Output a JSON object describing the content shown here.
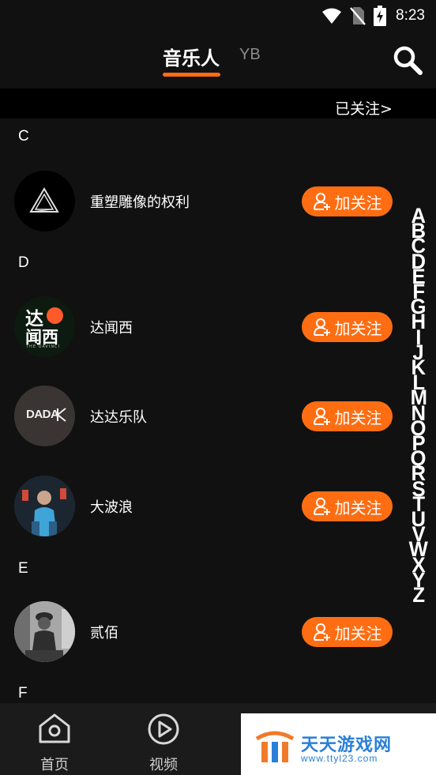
{
  "status_bar": {
    "time": "8:23",
    "icons": [
      "wifi-icon",
      "no-sim-icon",
      "battery-charging-icon"
    ]
  },
  "header": {
    "tab_active": "音乐人",
    "tab_other": "YB",
    "search_icon": "search-icon",
    "accent_color": "#ff6d13"
  },
  "followed_link": "已关注>",
  "sections": [
    {
      "letter": "C",
      "artists": [
        {
          "name": "重塑雕像的权利"
        }
      ]
    },
    {
      "letter": "D",
      "artists": [
        {
          "name": "达闻西"
        },
        {
          "name": "达达乐队"
        },
        {
          "name": "大波浪"
        }
      ]
    },
    {
      "letter": "E",
      "artists": [
        {
          "name": "贰佰"
        }
      ]
    },
    {
      "letter": "F",
      "artists": []
    }
  ],
  "follow_button_label": "加关注",
  "avatar_texts": {
    "dawenxi_top": "达",
    "dawenxi_bottom": "闻西",
    "dawenxi_sub": "THE DAVINCI",
    "dada": "DADA"
  },
  "alpha_index": [
    "A",
    "B",
    "C",
    "D",
    "E",
    "F",
    "G",
    "H",
    "I",
    "J",
    "K",
    "L",
    "M",
    "N",
    "O",
    "P",
    "Q",
    "R",
    "S",
    "T",
    "U",
    "V",
    "W",
    "X",
    "Y",
    "Z"
  ],
  "bottom_nav": [
    {
      "label": "首页",
      "icon": "home-icon"
    },
    {
      "label": "视频",
      "icon": "video-play-icon"
    }
  ],
  "watermark": {
    "title": "天天游戏网",
    "url": "www.ttyl23.com"
  }
}
